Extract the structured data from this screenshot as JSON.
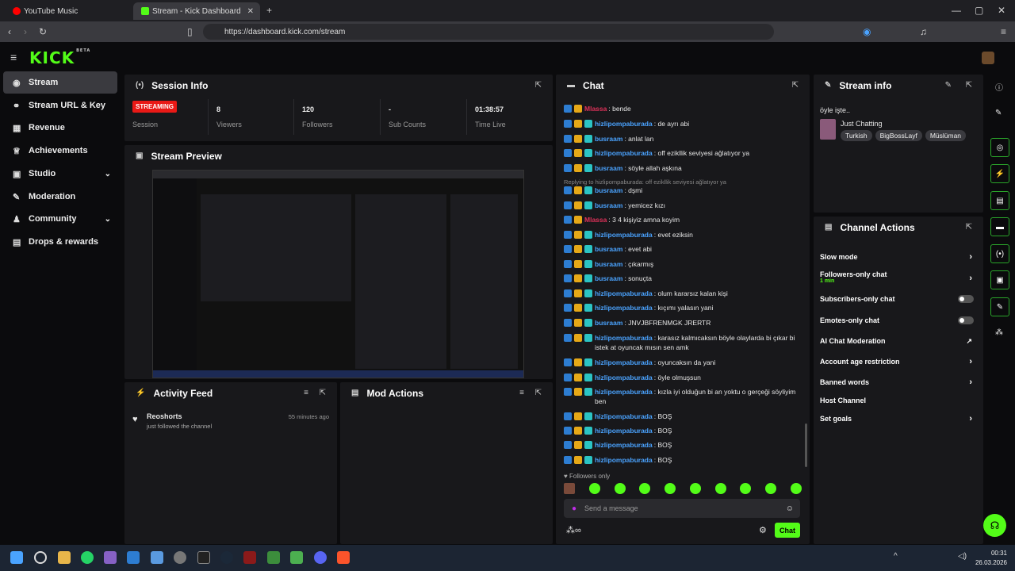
{
  "browser": {
    "tabs": [
      {
        "label": "YouTube Music",
        "active": false
      },
      {
        "label": "Stream - Kick Dashboard",
        "active": true
      }
    ],
    "url": "https://dashboard.kick.com/stream"
  },
  "logo": "KICK",
  "logo_badge": "BETA",
  "sidebar": {
    "items": [
      {
        "label": "Stream",
        "icon": "broadcast-icon"
      },
      {
        "label": "Stream URL & Key",
        "icon": "link-icon"
      },
      {
        "label": "Revenue",
        "icon": "revenue-icon"
      },
      {
        "label": "Achievements",
        "icon": "trophy-icon"
      },
      {
        "label": "Studio",
        "icon": "studio-icon"
      },
      {
        "label": "Moderation",
        "icon": "wrench-icon"
      },
      {
        "label": "Community",
        "icon": "community-icon"
      },
      {
        "label": "Drops & rewards",
        "icon": "gift-icon"
      }
    ]
  },
  "session": {
    "title": "Session Info",
    "stats": [
      {
        "value": "STREAMING",
        "label": "Session"
      },
      {
        "value": "8",
        "label": "Viewers"
      },
      {
        "value": "120",
        "label": "Followers"
      },
      {
        "value": "-",
        "label": "Sub Counts"
      },
      {
        "value": "01:38:57",
        "label": "Time Live"
      }
    ]
  },
  "preview": {
    "title": "Stream Preview"
  },
  "activity": {
    "title": "Activity Feed",
    "items": [
      {
        "user": "Reoshorts",
        "action": "just followed the channel",
        "time": "55 minutes ago"
      }
    ]
  },
  "mod_actions": {
    "title": "Mod Actions"
  },
  "chat": {
    "title": "Chat",
    "messages": [
      {
        "user": "Mlassa",
        "text": "bende",
        "color": "#e0325a"
      },
      {
        "user": "hizlipompaburada",
        "text": "de ayrı abi",
        "color": "#4aa3ff"
      },
      {
        "user": "busraam",
        "text": "anlat lan",
        "color": "#4aa3ff"
      },
      {
        "user": "hizlipompaburada",
        "text": "off ezikllik seviyesi ağlatıyor ya",
        "color": "#4aa3ff"
      },
      {
        "user": "busraam",
        "text": "söyle allah aşkına",
        "color": "#4aa3ff"
      },
      {
        "reply": "Replying to hizlipompaburada: off ezikllik seviyesi ağlatıyor ya"
      },
      {
        "user": "busraam",
        "text": "dşmi",
        "color": "#4aa3ff"
      },
      {
        "user": "busraam",
        "text": "yemicez kızı",
        "color": "#4aa3ff"
      },
      {
        "user": "Mlassa",
        "text": "3 4 kişiyiz amna koyim",
        "color": "#e0325a"
      },
      {
        "user": "hizlipompaburada",
        "text": "evet eziksin",
        "color": "#4aa3ff"
      },
      {
        "user": "busraam",
        "text": "evet abi",
        "color": "#4aa3ff"
      },
      {
        "user": "busraam",
        "text": "çıkarmış",
        "color": "#4aa3ff"
      },
      {
        "user": "busraam",
        "text": "sonuçta",
        "color": "#4aa3ff"
      },
      {
        "user": "hizlipompaburada",
        "text": "olum kararsız kalan kişi",
        "color": "#4aa3ff"
      },
      {
        "user": "hizlipompaburada",
        "text": "kıçımı yalasın yani",
        "color": "#4aa3ff"
      },
      {
        "user": "busraam",
        "text": "JNVJBFRENMGK JRERTR",
        "color": "#4aa3ff"
      },
      {
        "user": "hizlipompaburada",
        "text": "karasız kalmıcaksın böyle olaylarda bi çıkar bi istek at oyuncak mısın sen amk",
        "color": "#4aa3ff"
      },
      {
        "user": "hizlipompaburada",
        "text": "oyuncaksın da yani",
        "color": "#4aa3ff"
      },
      {
        "user": "hizlipompaburada",
        "text": "öyle olmuşsun",
        "color": "#4aa3ff"
      },
      {
        "user": "hizlipompaburada",
        "text": "kızla iyi olduğun bi an yoktu o gerçeği söyliyim ben",
        "color": "#4aa3ff"
      },
      {
        "user": "hizlipompaburada",
        "text": "BOŞ",
        "color": "#4aa3ff"
      },
      {
        "user": "hizlipompaburada",
        "text": "BOŞ",
        "color": "#4aa3ff"
      },
      {
        "user": "hizlipompaburada",
        "text": "BOŞ",
        "color": "#4aa3ff"
      },
      {
        "user": "hizlipompaburada",
        "text": "BOŞ",
        "color": "#4aa3ff"
      }
    ],
    "followers_only": "Followers only",
    "placeholder": "Send a message",
    "send_label": "Chat"
  },
  "stream_info": {
    "title": "Stream info",
    "stream_title": "öyle işte..",
    "category": "Just Chatting",
    "tags": [
      "Turkish",
      "BigBossLayf",
      "Müslüman"
    ]
  },
  "channel_actions": {
    "title": "Channel Actions",
    "items": [
      {
        "label": "Slow mode",
        "control": "arrow"
      },
      {
        "label": "Followers-only chat",
        "sub": "1 min",
        "control": "arrow"
      },
      {
        "label": "Subscribers-only chat",
        "control": "toggle"
      },
      {
        "label": "Emotes-only chat",
        "control": "toggle"
      },
      {
        "label": "AI Chat Moderation",
        "control": "external"
      },
      {
        "label": "Account age restriction",
        "control": "arrow"
      },
      {
        "label": "Banned words",
        "control": "arrow"
      },
      {
        "label": "Host Channel",
        "control": "none"
      },
      {
        "label": "Set goals",
        "control": "arrow"
      }
    ]
  },
  "clock": {
    "time": "00:31",
    "date": "26.03.2026"
  },
  "colors": {
    "accent": "#53fc18",
    "live": "#e91916",
    "panel": "#18181b"
  }
}
